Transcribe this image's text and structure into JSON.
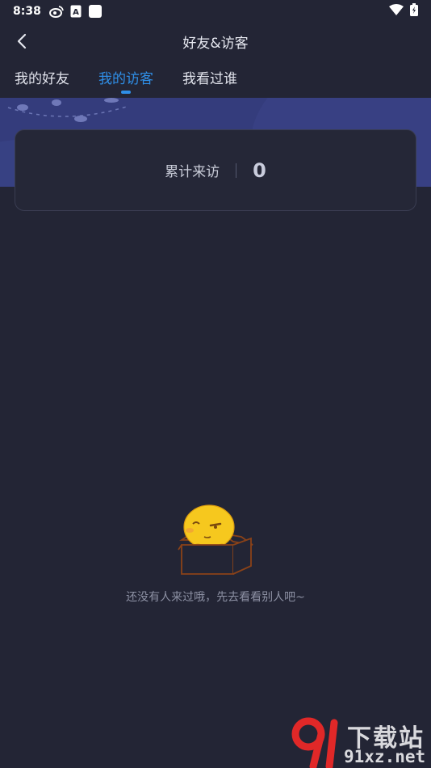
{
  "status_bar": {
    "time": "8:38",
    "notification_box_letter": "A"
  },
  "header": {
    "title": "好友&访客"
  },
  "tabs": [
    {
      "label": "我的好友",
      "active": false
    },
    {
      "label": "我的访客",
      "active": true
    },
    {
      "label": "我看过谁",
      "active": false
    }
  ],
  "stats": {
    "label": "累计来访",
    "value": "0"
  },
  "empty_state": {
    "message": "还没有人来过哦，先去看看别人吧~"
  },
  "watermark": {
    "top_text": "下载站",
    "bottom_text": "91xz.net"
  },
  "colors": {
    "background": "#232535",
    "accent": "#2f8fe8",
    "banner": "#343c7c"
  },
  "icons": [
    "back-arrow-icon",
    "weibo-icon",
    "wifi-icon",
    "battery-icon",
    "empty-box-mascot"
  ]
}
